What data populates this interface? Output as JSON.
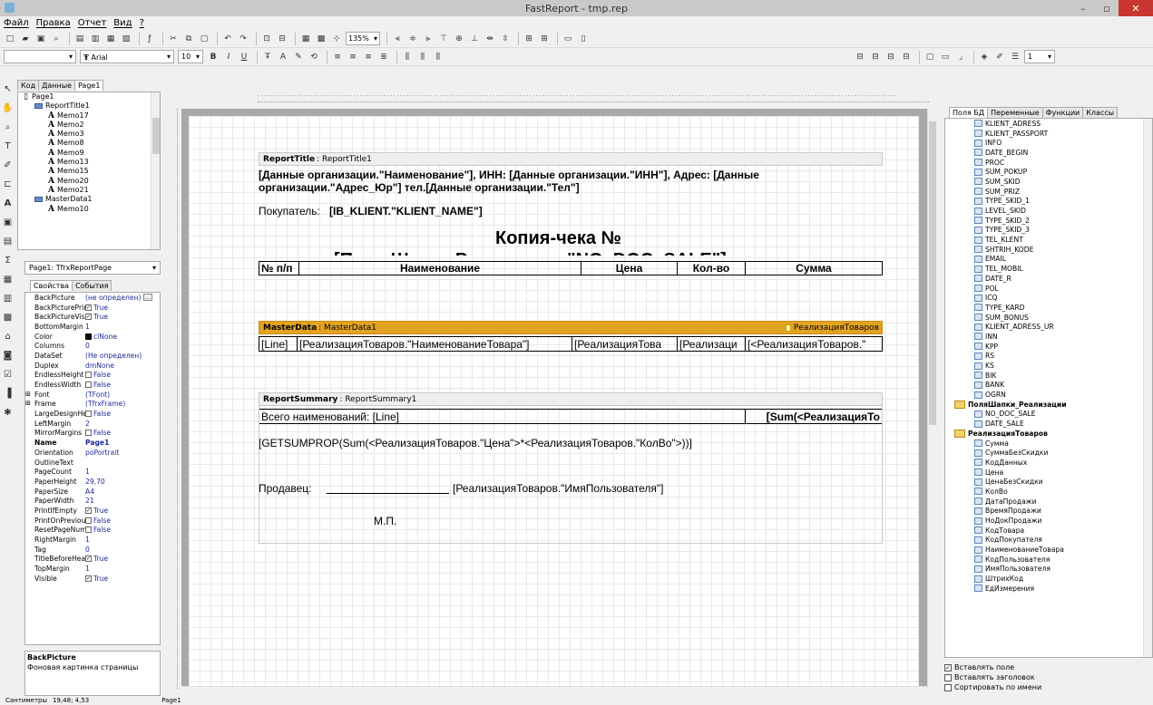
{
  "window": {
    "title": "FastReport - tmp.rep",
    "minimize": "–",
    "maximize": "▫",
    "close": "✕"
  },
  "menu": [
    "Файл",
    "Правка",
    "Отчет",
    "Вид",
    "?"
  ],
  "toolbar": {
    "zoom": "135%",
    "font_size": "10",
    "font_name": "Arial",
    "line_width": "1"
  },
  "design_tabs": [
    "Код",
    "Данные",
    "Page1"
  ],
  "tree": [
    {
      "label": "Page1",
      "kind": "page",
      "level": 0
    },
    {
      "label": "ReportTitle1",
      "kind": "band",
      "level": 1
    },
    {
      "label": "Memo17",
      "kind": "memo",
      "level": 2
    },
    {
      "label": "Memo2",
      "kind": "memo",
      "level": 2
    },
    {
      "label": "Memo3",
      "kind": "memo",
      "level": 2
    },
    {
      "label": "Memo8",
      "kind": "memo",
      "level": 2
    },
    {
      "label": "Memo9",
      "kind": "memo",
      "level": 2
    },
    {
      "label": "Memo13",
      "kind": "memo",
      "level": 2
    },
    {
      "label": "Memo15",
      "kind": "memo",
      "level": 2
    },
    {
      "label": "Memo20",
      "kind": "memo",
      "level": 2
    },
    {
      "label": "Memo21",
      "kind": "memo",
      "level": 2
    },
    {
      "label": "MasterData1",
      "kind": "band",
      "level": 1
    },
    {
      "label": "Memo10",
      "kind": "memo",
      "level": 2
    }
  ],
  "object_selector": "Page1: TfrxReportPage",
  "prop_tabs": [
    "Свойства",
    "События"
  ],
  "properties": [
    {
      "name": "BackPicture",
      "value": "(не определен)",
      "ellipsis": true
    },
    {
      "name": "BackPicturePrint",
      "value": "True",
      "check": true
    },
    {
      "name": "BackPictureVisib",
      "value": "True",
      "check": true
    },
    {
      "name": "BottomMargin",
      "value": "1"
    },
    {
      "name": "Color",
      "value": "clNone",
      "swatch": true
    },
    {
      "name": "Columns",
      "value": "0"
    },
    {
      "name": "DataSet",
      "value": "(Не определен)"
    },
    {
      "name": "Duplex",
      "value": "dmNone"
    },
    {
      "name": "EndlessHeight",
      "value": "False",
      "check": false
    },
    {
      "name": "EndlessWidth",
      "value": "False",
      "check": false
    },
    {
      "name": "Font",
      "value": "(TFont)",
      "expand": true
    },
    {
      "name": "Frame",
      "value": "(TfrxFrame)",
      "expand": true
    },
    {
      "name": "LargeDesignHei",
      "value": "False",
      "check": false
    },
    {
      "name": "LeftMargin",
      "value": "2"
    },
    {
      "name": "MirrorMargins",
      "value": "False",
      "check": false
    },
    {
      "name": "Name",
      "value": "Page1",
      "bold": true
    },
    {
      "name": "Orientation",
      "value": "poPortrait"
    },
    {
      "name": "OutlineText",
      "value": ""
    },
    {
      "name": "PageCount",
      "value": "1"
    },
    {
      "name": "PaperHeight",
      "value": "29,70"
    },
    {
      "name": "PaperSize",
      "value": "A4"
    },
    {
      "name": "PaperWidth",
      "value": "21"
    },
    {
      "name": "PrintIfEmpty",
      "value": "True",
      "check": true
    },
    {
      "name": "PrintOnPrevious",
      "value": "False",
      "check": false
    },
    {
      "name": "ResetPageNuml",
      "value": "False",
      "check": false
    },
    {
      "name": "RightMargin",
      "value": "1"
    },
    {
      "name": "Tag",
      "value": "0"
    },
    {
      "name": "TitleBeforeHeac",
      "value": "True",
      "check": true
    },
    {
      "name": "TopMargin",
      "value": "1"
    },
    {
      "name": "Visible",
      "value": "True",
      "check": true
    }
  ],
  "help": {
    "title": "BackPicture",
    "text": "Фоновая картинка страницы"
  },
  "report": {
    "title_band": {
      "type": "ReportTitle",
      "name": ": ReportTitle1"
    },
    "org_line1": "[Данные организации.\"Наименование\"], ИНН: [Данные организации.\"ИНН\"], Адрес: [Данные",
    "org_line2": "организации.\"Адрес_Юр\"] тел.[Данные организации.\"Тел\"]",
    "buyer_label": "Покупатель:",
    "buyer_value": "[IB_KLIENT.\"KLIENT_NAME\"]",
    "receipt_title": "Копия-чека №",
    "receipt_sub": "[Поля Шапки Реализации.\"NO_DOC_SALE\"]",
    "col_headers": [
      "№ п/п",
      "Наименование",
      "Цена",
      "Кол-во",
      "Сумма"
    ],
    "master_band": {
      "type": "MasterData",
      "name": ": MasterData1",
      "dataset": "РеализацияТоваров"
    },
    "master_cells": [
      "[Line]",
      "[РеализацияТоваров.\"НаименованиеТовара\"]",
      "[РеализацияТова",
      "[Реализаци",
      "[<РеализацияТоваров.\""
    ],
    "summary_band": {
      "type": "ReportSummary",
      "name": ": ReportSummary1"
    },
    "total_items": "Всего наименований: [Line]",
    "total_sum": "[Sum(<РеализацияТо",
    "getsum": "[GETSUMPROP(Sum(<РеализацияТоваров.\"Цена\">*<РеализацияТоваров.\"КолВо\">))]",
    "seller_label": "Продавец:",
    "seller_value": "[РеализацияТоваров.\"ИмяПользователя\"]",
    "stamp": "М.П."
  },
  "right_tabs": [
    "Поля БД",
    "Переменные",
    "Функции",
    "Классы"
  ],
  "fields": [
    {
      "label": "KLIENT_ADRESS"
    },
    {
      "label": "KLIENT_PASSPORT"
    },
    {
      "label": "INFO"
    },
    {
      "label": "DATE_BEGIN"
    },
    {
      "label": "PROC"
    },
    {
      "label": "SUM_POKUP"
    },
    {
      "label": "SUM_SKID"
    },
    {
      "label": "SUM_PRIZ"
    },
    {
      "label": "TYPE_SKID_1"
    },
    {
      "label": "LEVEL_SKID"
    },
    {
      "label": "TYPE_SKID_2"
    },
    {
      "label": "TYPE_SKID_3"
    },
    {
      "label": "TEL_KLENT"
    },
    {
      "label": "SHTRIH_KODE"
    },
    {
      "label": "EMAIL"
    },
    {
      "label": "TEL_MOBIL"
    },
    {
      "label": "DATE_R"
    },
    {
      "label": "POL"
    },
    {
      "label": "ICQ"
    },
    {
      "label": "TYPE_KARD"
    },
    {
      "label": "SUM_BONUS"
    },
    {
      "label": "KLIENT_ADRESS_UR"
    },
    {
      "label": "INN"
    },
    {
      "label": "KPP"
    },
    {
      "label": "RS"
    },
    {
      "label": "KS"
    },
    {
      "label": "BIK"
    },
    {
      "label": "BANK"
    },
    {
      "label": "OGRN"
    },
    {
      "label": "ПоляШапки_Реализации",
      "group": true
    },
    {
      "label": "NO_DOC_SALE"
    },
    {
      "label": "DATE_SALE"
    },
    {
      "label": "РеализацияТоваров",
      "group": true
    },
    {
      "label": "Сумма"
    },
    {
      "label": "СуммаБезСкидки"
    },
    {
      "label": "КодДанных"
    },
    {
      "label": "Цена"
    },
    {
      "label": "ЦенаБезСкидки"
    },
    {
      "label": "КолВо"
    },
    {
      "label": "ДатаПродажи"
    },
    {
      "label": "ВремяПродажи"
    },
    {
      "label": "НоДокПродажи"
    },
    {
      "label": "КодТовара"
    },
    {
      "label": "КодПокупателя"
    },
    {
      "label": "НаименованиеТовара"
    },
    {
      "label": "КодПользователя"
    },
    {
      "label": "ИмяПользователя"
    },
    {
      "label": "ШтрихКод"
    },
    {
      "label": "ЕдИзмерения"
    }
  ],
  "options": [
    {
      "label": "Вставлять поле",
      "checked": true
    },
    {
      "label": "Вставлять заголовок",
      "checked": false
    },
    {
      "label": "Сортировать по имени",
      "checked": false
    }
  ],
  "status": {
    "units": "Сантиметры",
    "coords": "19,48; 4,53",
    "page": "Page1"
  },
  "colors": {
    "master_band": "#e3a322",
    "close_button": "#c7372f",
    "value_text": "#1e2a9a"
  }
}
